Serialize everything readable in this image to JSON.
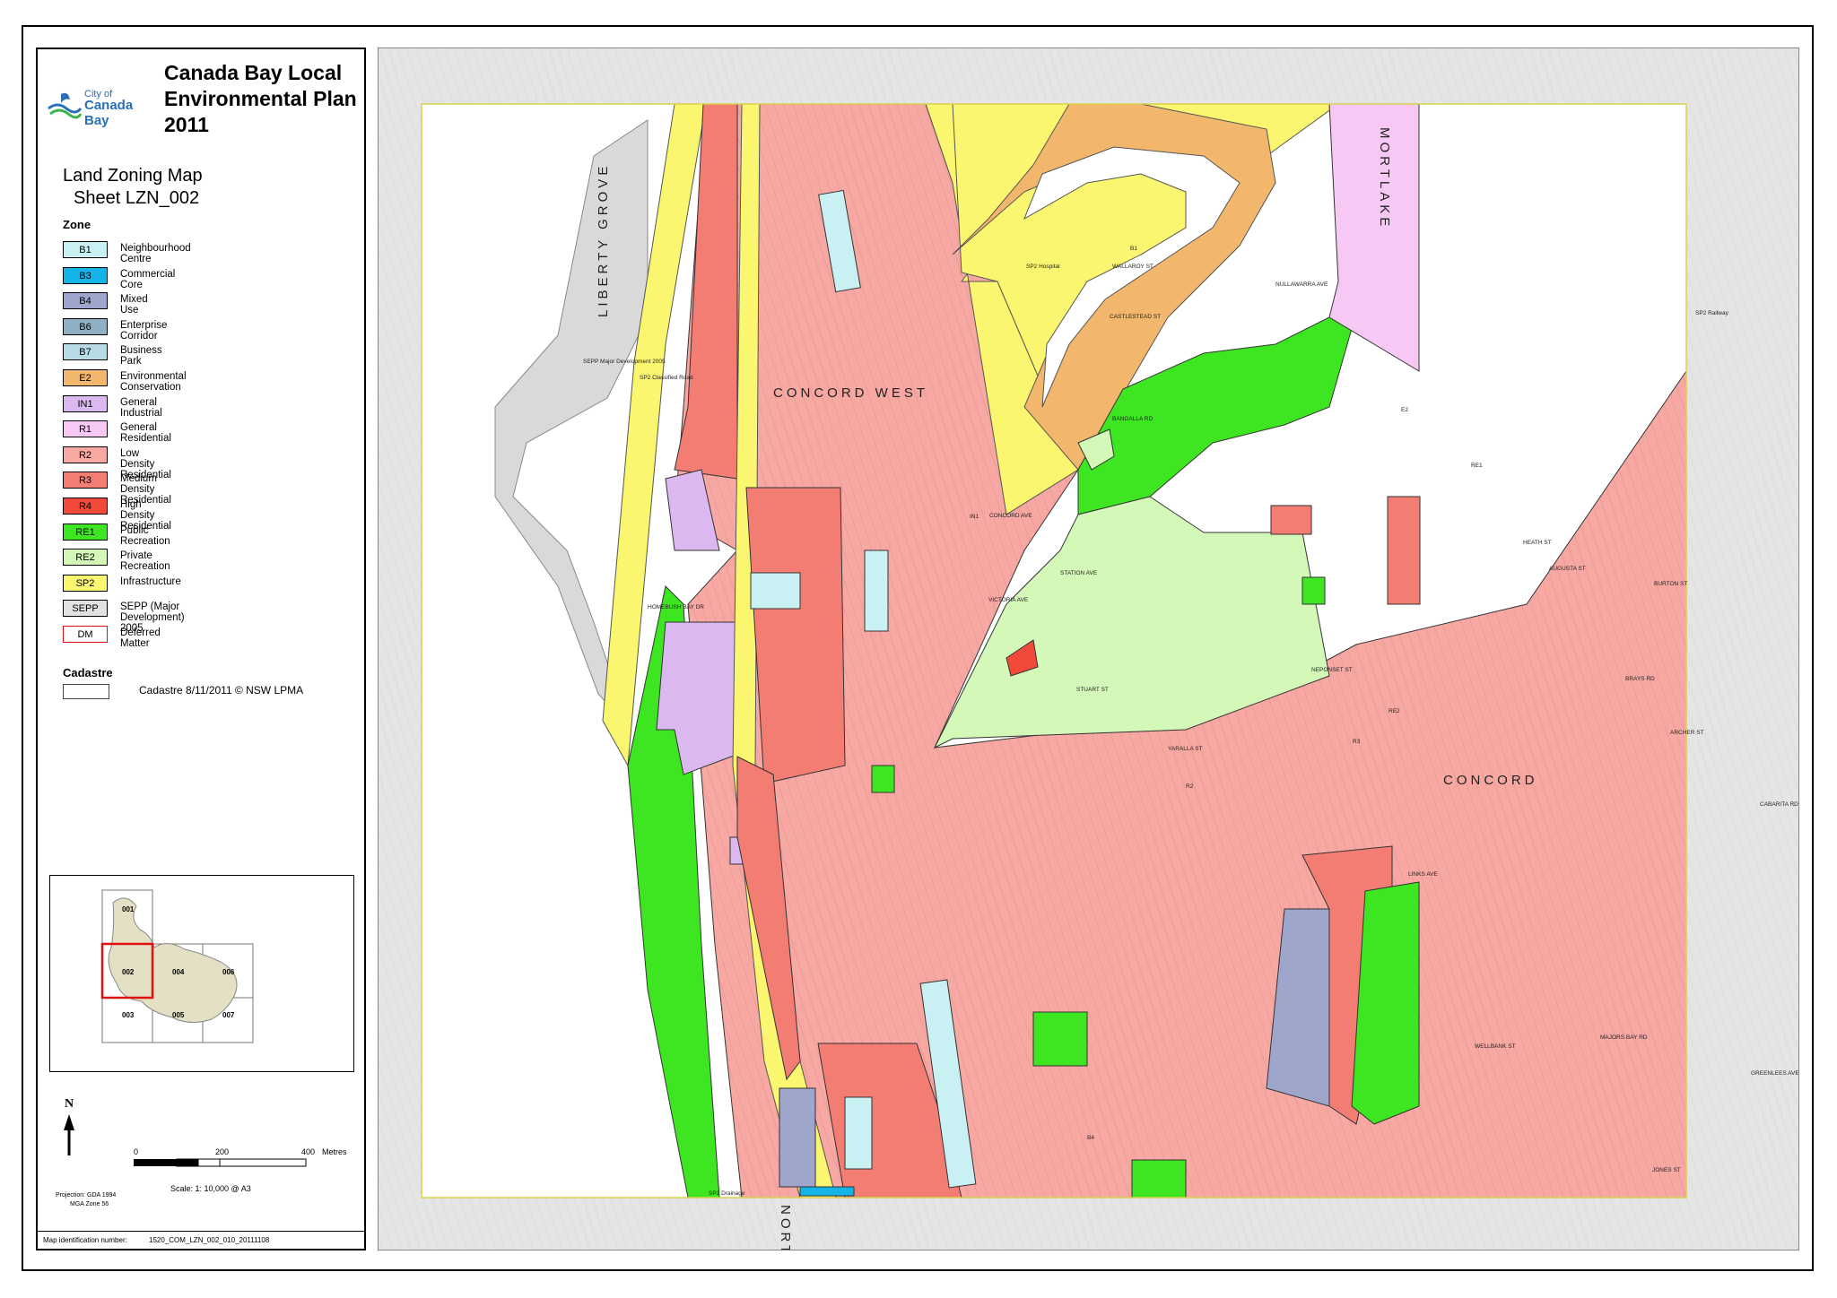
{
  "header": {
    "title": "Canada Bay Local Environmental Plan 2011",
    "logo_city": "City of",
    "logo_name": "Canada Bay",
    "map_name": "Land Zoning Map",
    "sheet": "Sheet LZN_002"
  },
  "legend": {
    "heading": "Zone",
    "zones": [
      {
        "code": "B1",
        "label": "Neighbourhood Centre",
        "color": "#c9f0f2"
      },
      {
        "code": "B3",
        "label": "Commercial Core",
        "color": "#14b4e8"
      },
      {
        "code": "B4",
        "label": "Mixed Use",
        "color": "#9fa6cc"
      },
      {
        "code": "B6",
        "label": "Enterprise Corridor",
        "color": "#8fb0c3"
      },
      {
        "code": "B7",
        "label": "Business Park",
        "color": "#b7dce8"
      },
      {
        "code": "E2",
        "label": "Environmental Conservation",
        "color": "#f2b66c"
      },
      {
        "code": "IN1",
        "label": "General Industrial",
        "color": "#dbb9f0"
      },
      {
        "code": "R1",
        "label": "General Residential",
        "color": "#f8c8f4"
      },
      {
        "code": "R2",
        "label": "Low Density Residential",
        "color": "#f7a8a3"
      },
      {
        "code": "R3",
        "label": "Medium Density Residential",
        "color": "#f47d73"
      },
      {
        "code": "R4",
        "label": "High Density Residential",
        "color": "#f24a3a"
      },
      {
        "code": "RE1",
        "label": "Public Recreation",
        "color": "#3ee621"
      },
      {
        "code": "RE2",
        "label": "Private Recreation",
        "color": "#d4f8b8"
      },
      {
        "code": "SP2",
        "label": "Infrastructure",
        "color": "#fbf66f"
      },
      {
        "code": "SEPP",
        "label": "SEPP (Major Development) 2005",
        "color": "#e2e2e2"
      },
      {
        "code": "DM",
        "label": "Deferred Matter",
        "color": "#ffffff"
      }
    ],
    "cadastre_heading": "Cadastre",
    "cadastre_label": "Cadastre 8/11/2011 © NSW LPMA"
  },
  "keymap": {
    "sheets": [
      "001",
      "002",
      "003",
      "004",
      "005",
      "006",
      "007"
    ],
    "current": "002"
  },
  "scalebar": {
    "north": "N",
    "ticks": [
      "0",
      "200",
      "400"
    ],
    "unit": "Metres",
    "scale": "Scale: 1: 10,000 @ A3",
    "projection": "Projection: GDA 1994",
    "zone": "MGA Zone 56"
  },
  "footer": {
    "id_label": "Map identification number:",
    "id_value": "1520_COM_LZN_002_010_20111108"
  },
  "map": {
    "localities": [
      "LIBERTY GROVE",
      "CONCORD WEST",
      "CONCORD",
      "MORTLAKE",
      "NORTH"
    ],
    "labels": [
      "SP2 Hospital",
      "SEPP Major Development 2005",
      "SP2 Classified Road",
      "SP2 Railway",
      "SP2 Drainage",
      "RE1",
      "RE2",
      "R3",
      "IN1",
      "B1",
      "B4",
      "E2",
      "R2"
    ],
    "streets": [
      "CONCORD AVE",
      "STATION AVE",
      "VICTORIA AVE",
      "YARALLA ST",
      "STUART ST",
      "NULLAWARRA AVE",
      "CASTLESTEAD ST",
      "WALLAROY ST",
      "BANGALLA RD",
      "NEPONSET ST",
      "HEATH ST",
      "AUGUSTA ST",
      "BURTON ST",
      "LINKS AVE",
      "GREENLEES AVE",
      "WELLBANK ST",
      "MAJORS BAY RD",
      "JONES ST",
      "ARCHER ST",
      "BRAYS RD",
      "CABARITA RD",
      "HOMEBUSH BAY DR"
    ]
  }
}
